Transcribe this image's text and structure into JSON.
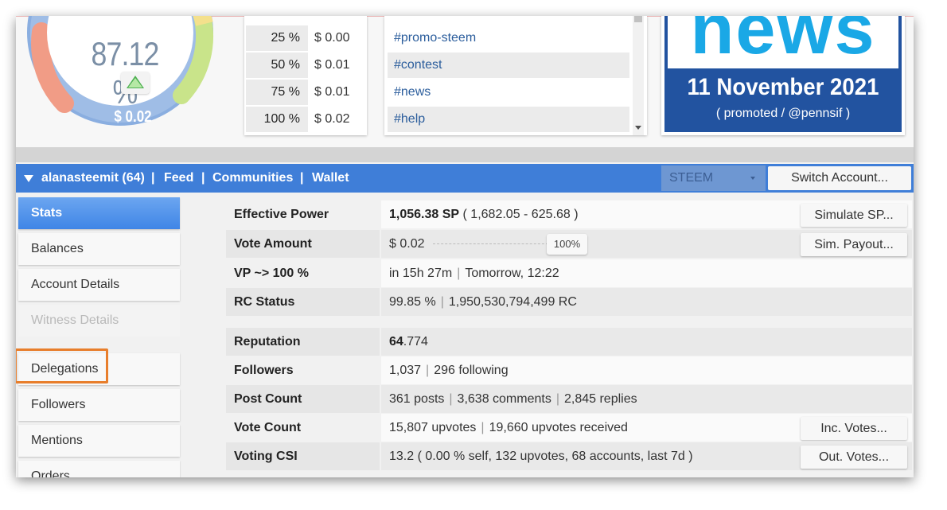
{
  "gauge": {
    "percent_text": "87.12 %",
    "money_text": "$ 0.02",
    "level": 0.8712
  },
  "payout_table": [
    {
      "pct": "25 %",
      "value": "$ 0.00"
    },
    {
      "pct": "50 %",
      "value": "$ 0.01"
    },
    {
      "pct": "75 %",
      "value": "$ 0.01"
    },
    {
      "pct": "100 %",
      "value": "$ 0.02"
    }
  ],
  "tags": [
    "#promo-steem",
    "#contest",
    "#news",
    "#help"
  ],
  "news_banner": {
    "word": "news",
    "date": "11 November 2021",
    "promo": "( promoted / @pennsif )"
  },
  "navbar": {
    "account": "alanasteemit (64)",
    "separator": "|",
    "links": [
      "Feed",
      "Communities",
      "Wallet"
    ],
    "currency_select": "STEEM",
    "switch_button": "Switch Account..."
  },
  "sidebar": {
    "items": [
      {
        "label": "Stats",
        "state": "active"
      },
      {
        "label": "Balances",
        "state": "normal"
      },
      {
        "label": "Account Details",
        "state": "normal"
      },
      {
        "label": "Witness Details",
        "state": "disabled"
      },
      {
        "label": "Delegations",
        "state": "normal"
      },
      {
        "label": "Followers",
        "state": "normal"
      },
      {
        "label": "Mentions",
        "state": "normal"
      },
      {
        "label": "Orders",
        "state": "normal"
      }
    ]
  },
  "stats": {
    "effective_power": {
      "label": "Effective Power",
      "sp": "1,056.38 SP",
      "detail": "( 1,682.05 - 625.68 )",
      "button": "Simulate SP..."
    },
    "vote_amount": {
      "label": "Vote Amount",
      "value": "$ 0.02",
      "slider_pct": "100%",
      "slider_level": 1.0,
      "button": "Sim. Payout..."
    },
    "vp": {
      "label": "VP ~> 100 %",
      "a": "in 15h 27m",
      "b": "Tomorrow, 12:22"
    },
    "rc": {
      "label": "RC Status",
      "a": "99.85 %",
      "b": "1,950,530,794,499 RC"
    },
    "reputation": {
      "label": "Reputation",
      "int": "64",
      "dec": ".774"
    },
    "followers": {
      "label": "Followers",
      "a": "1,037",
      "b": "296 following"
    },
    "post_count": {
      "label": "Post Count",
      "a": "361 posts",
      "b": "3,638 comments",
      "c": "2,845 replies"
    },
    "vote_count": {
      "label": "Vote Count",
      "a": "15,807 upvotes",
      "b": "19,660 upvotes received",
      "button": "Inc. Votes..."
    },
    "voting_csi": {
      "label": "Voting CSI",
      "value": "13.2 ( 0.00 % self, 132 upvotes, 68 accounts, last 7d )",
      "button": "Out. Votes..."
    }
  },
  "colors": {
    "nav_blue": "#3f7ed8",
    "news_blue": "#2253a0",
    "news_word": "#1aa8e6",
    "highlight_orange": "#e87e2c",
    "link_blue": "#2b5d9c"
  }
}
